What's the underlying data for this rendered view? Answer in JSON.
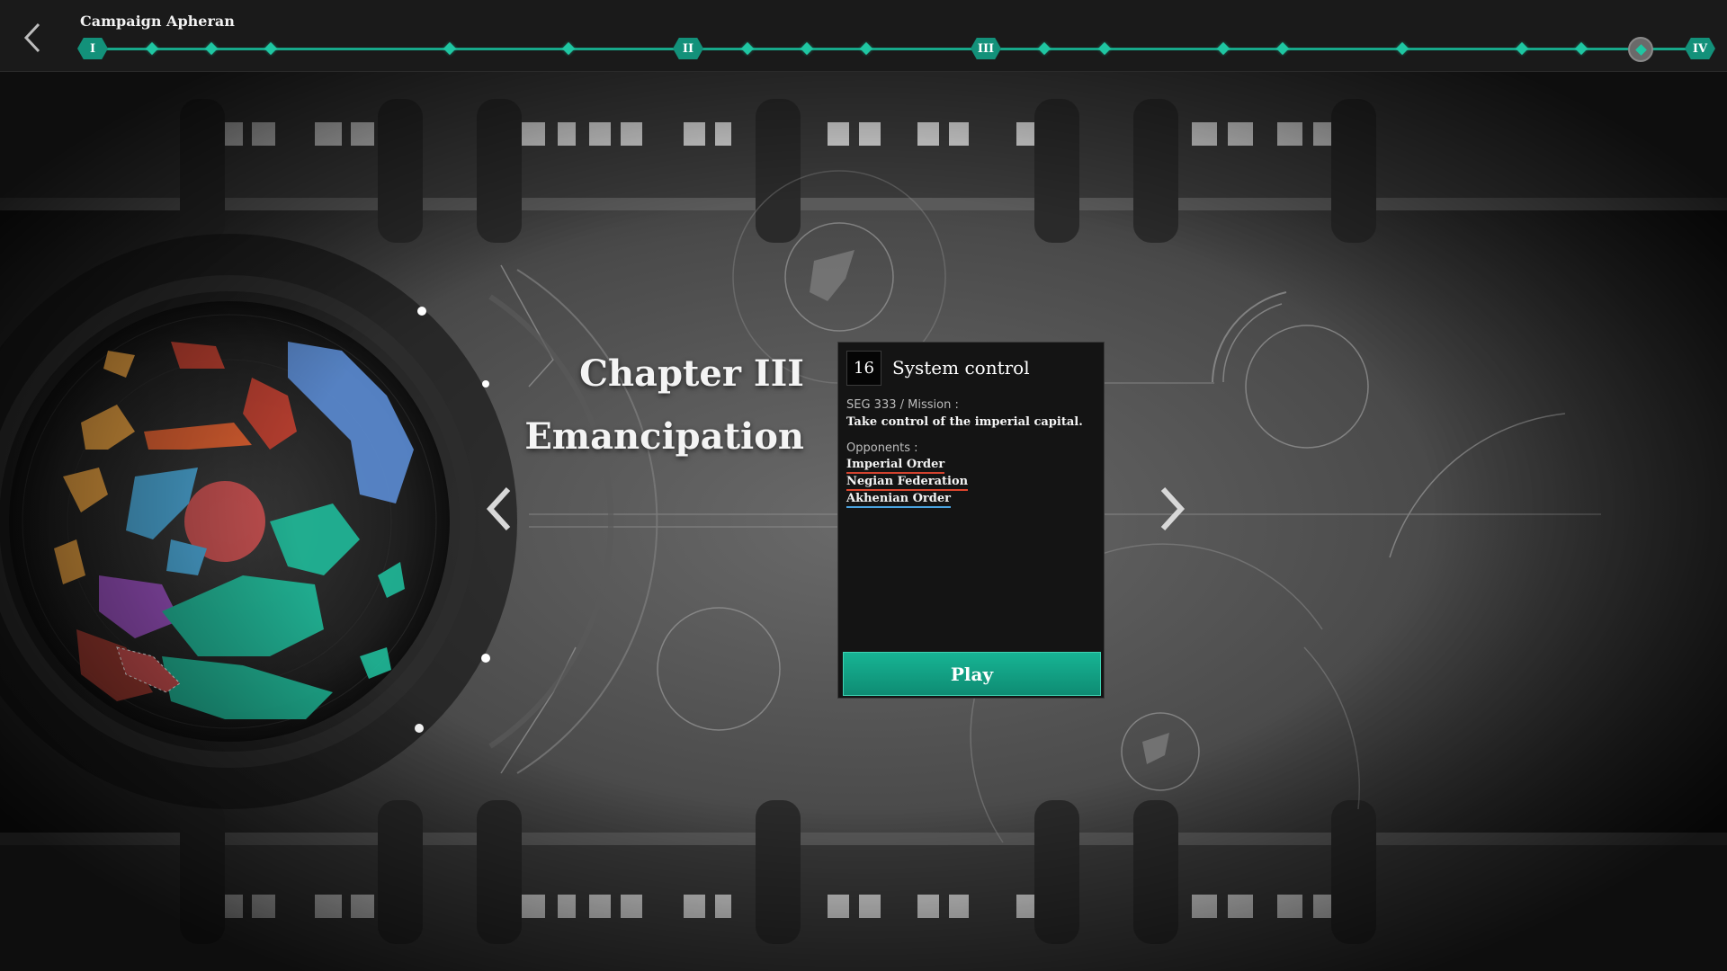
{
  "header": {
    "back_icon": "chevron-left-icon",
    "campaign_title": "Campaign Apheran"
  },
  "timeline": {
    "accent_color": "#17a88a",
    "chapters": [
      "I",
      "II",
      "III",
      "IV"
    ],
    "current_marker": "current-mission-marker"
  },
  "chapter": {
    "label": "Chapter III",
    "name": "Emancipation"
  },
  "mission": {
    "number": "16",
    "title": "System control",
    "seg_label": "SEG 333 / Mission :",
    "description": "Take control of the imperial capital.",
    "opponents_label": "Opponents :",
    "opponents": [
      {
        "name": "Imperial Order",
        "color": "#d4432f"
      },
      {
        "name": "Negian Federation",
        "color": "#e0462e"
      },
      {
        "name": "Akhenian Order",
        "color": "#4aa3e0"
      }
    ],
    "play_label": "Play"
  },
  "colors": {
    "play_button": "#13a285",
    "faction_orange": "#e8a040",
    "faction_red": "#c04030",
    "faction_blue": "#5a8ad0",
    "faction_cyan": "#4aa8d8",
    "faction_teal": "#20b898",
    "faction_purple": "#9a50c0"
  }
}
